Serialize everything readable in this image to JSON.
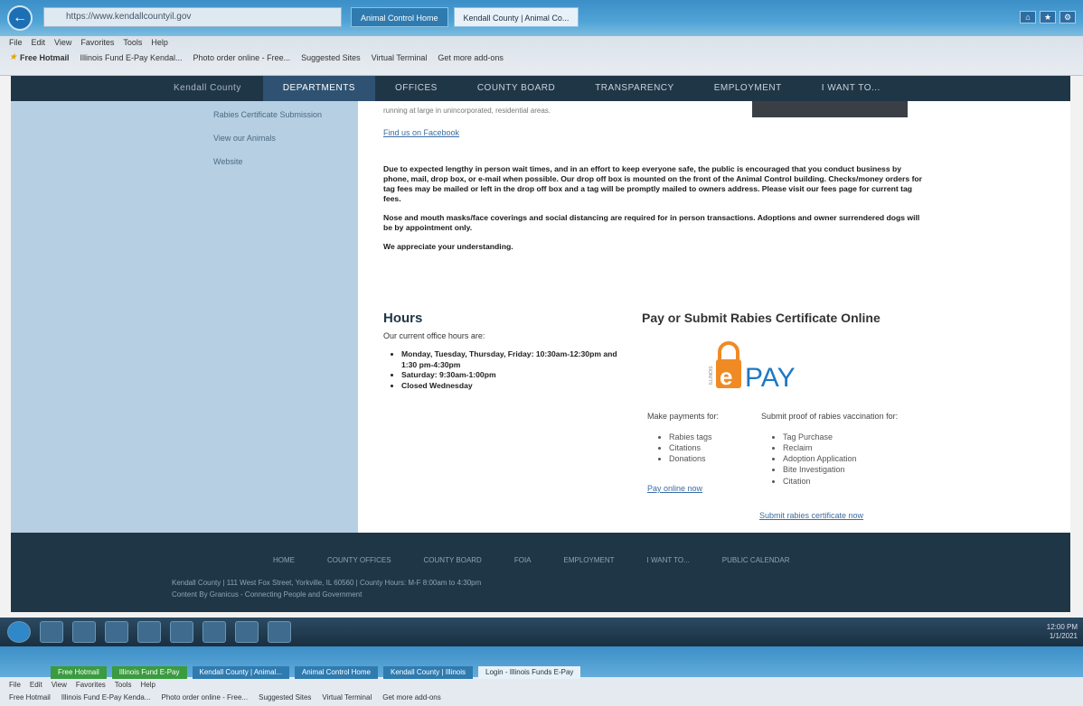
{
  "browser": {
    "url_text": "https://www.kendallcountyil.gov",
    "tabs": [
      "Animal Control Home",
      "Kendall County | Animal Co..."
    ],
    "menu": [
      "File",
      "Edit",
      "View",
      "Favorites",
      "Tools",
      "Help"
    ],
    "favorites": [
      "Free Hotmail",
      "Illinois Fund E-Pay Kendal...",
      "Photo order online - Free...",
      "Suggested Sites",
      "Virtual Terminal",
      "Get more add-ons"
    ]
  },
  "nav": {
    "brand": "Kendall County",
    "items": [
      "DEPARTMENTS",
      "OFFICES",
      "COUNTY BOARD",
      "TRANSPARENCY",
      "EMPLOYMENT",
      "I WANT TO..."
    ]
  },
  "sidebar": {
    "links": [
      "Rabies Certificate Submission",
      "View our Animals",
      "Website"
    ]
  },
  "content": {
    "fragment": "running at large in unincorporated, residential areas.",
    "facebook_link": "Find us on Facebook",
    "notice_1": "Due to expected lengthy in person wait times, and in an effort to keep everyone safe, the public is encouraged that you conduct business by phone, mail, drop box, or e-mail when possible. Our drop off box is mounted on the front of the Animal Control building. Checks/money orders for tag fees may be mailed or left in the drop off box and a tag will be promptly mailed to owners address. Please visit our fees page for current tag fees.",
    "notice_2": "Nose and mouth masks/face coverings and social distancing are required for in person transactions. Adoptions and owner surrendered dogs will be by appointment only.",
    "notice_3": "We appreciate your understanding."
  },
  "hours": {
    "title": "Hours",
    "intro": "Our current office hours are:",
    "items": [
      "Monday, Tuesday, Thursday, Friday: 10:30am-12:30pm and 1:30 pm-4:30pm",
      "Saturday: 9:30am-1:00pm",
      "Closed Wednesday"
    ]
  },
  "pay": {
    "title": "Pay or Submit Rabies Certificate Online",
    "logo_text": "PAY",
    "logo_side": "ILLINOIS",
    "payments_head": "Make payments for:",
    "payments": [
      "Rabies tags",
      "Citations",
      "Donations"
    ],
    "pay_link": "Pay online now",
    "submit_head": "Submit proof of rabies vaccination for:",
    "submit": [
      "Tag Purchase",
      "Reclaim",
      "Adoption Application",
      "Bite Investigation",
      "Citation"
    ],
    "submit_link": "Submit rabies certificate now"
  },
  "footer": {
    "links": [
      "HOME",
      "COUNTY OFFICES",
      "COUNTY BOARD",
      "FOIA",
      "EMPLOYMENT",
      "I WANT TO...",
      "PUBLIC CALENDAR"
    ],
    "address": "Kendall County   |   111 West Fox Street, Yorkville, IL 60560   |   County Hours: M-F 8:00am to 4:30pm",
    "credit": "Content By Granicus - Connecting People and Government"
  },
  "taskbar": {
    "time": "12:00 PM",
    "date": "1/1/2021"
  },
  "bottom_browser": {
    "tabs": [
      "Free Hotmail",
      "Illinois Fund E-Pay",
      "Kendall County | Animal...",
      "Animal Control Home",
      "Kendall County | Illinois",
      "Login - Illinois Funds E-Pay"
    ],
    "menu": [
      "File",
      "Edit",
      "View",
      "Favorites",
      "Tools",
      "Help"
    ],
    "favorites": [
      "Free Hotmail",
      "Illinois Fund E-Pay Kenda...",
      "Photo order online - Free...",
      "Suggested Sites",
      "Virtual Terminal",
      "Get more add-ons"
    ]
  },
  "colors": {
    "nav_bg": "#1f3647",
    "sidebar_bg": "#b6cfe2",
    "epay_orange": "#f08a24",
    "epay_blue": "#1e78c2"
  }
}
